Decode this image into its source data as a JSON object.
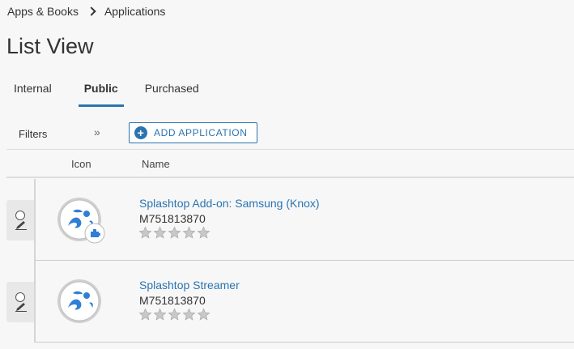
{
  "breadcrumb": {
    "parent": "Apps & Books",
    "current": "Applications"
  },
  "page": {
    "title": "List View"
  },
  "tabs": [
    {
      "label": "Internal",
      "active": false
    },
    {
      "label": "Public",
      "active": true
    },
    {
      "label": "Purchased",
      "active": false
    }
  ],
  "toolbar": {
    "filters_label": "Filters",
    "expand_icon": "»",
    "add_button_label": "ADD APPLICATION"
  },
  "grid": {
    "columns": {
      "icon": "Icon",
      "name": "Name"
    },
    "rows": [
      {
        "name": "Splashtop Add-on: Samsung (Knox)",
        "id": "M751813870",
        "rating": 0,
        "icon": "splashtop-addon-icon",
        "addon_badge": true
      },
      {
        "name": "Splashtop Streamer",
        "id": "M751813870",
        "rating": 0,
        "icon": "splashtop-icon",
        "addon_badge": false
      }
    ]
  },
  "colors": {
    "accent": "#2a74b0",
    "splash_blue": "#2f7fd6"
  }
}
